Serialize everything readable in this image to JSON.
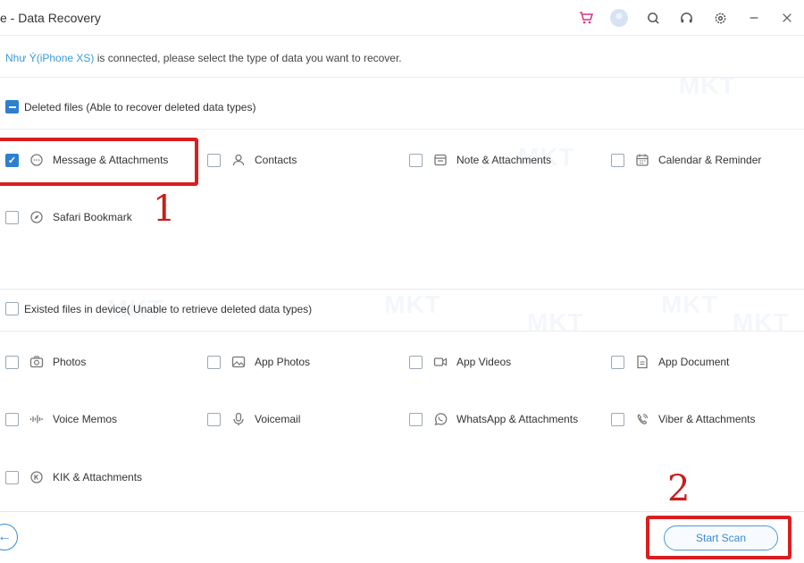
{
  "window": {
    "title": "e - Data Recovery",
    "icons": [
      "cart-icon",
      "user-avatar-icon",
      "search-icon",
      "headset-icon",
      "settings-icon",
      "minimize-icon",
      "close-icon"
    ]
  },
  "connection": {
    "device": "Như Ý(iPhone XS)",
    "message": " is connected, please select the type of data you want to recover."
  },
  "deleted_section": {
    "label": "Deleted files (Able to recover deleted data types)",
    "items": [
      {
        "label": "Message & Attachments",
        "checked": true
      },
      {
        "label": "Contacts",
        "checked": false
      },
      {
        "label": "Note & Attachments",
        "checked": false
      },
      {
        "label": "Calendar & Reminder",
        "checked": false
      },
      {
        "label": "Safari Bookmark",
        "checked": false
      }
    ]
  },
  "existing_section": {
    "label": "Existed files in device( Unable to retrieve deleted data types)",
    "items": [
      {
        "label": "Photos",
        "checked": false
      },
      {
        "label": "App Photos",
        "checked": false
      },
      {
        "label": "App Videos",
        "checked": false
      },
      {
        "label": "App Document",
        "checked": false
      },
      {
        "label": "Voice Memos",
        "checked": false
      },
      {
        "label": "Voicemail",
        "checked": false
      },
      {
        "label": "WhatsApp & Attachments",
        "checked": false
      },
      {
        "label": "Viber & Attachments",
        "checked": false
      },
      {
        "label": "KIK & Attachments",
        "checked": false
      }
    ]
  },
  "annotations": {
    "step1": "1",
    "step2": "2",
    "color": "#d81f1f"
  },
  "footer": {
    "scan_label": "Start Scan"
  },
  "watermark": "MKT",
  "colors": {
    "accent": "#2f7fcf",
    "link": "#3a9ad9"
  }
}
